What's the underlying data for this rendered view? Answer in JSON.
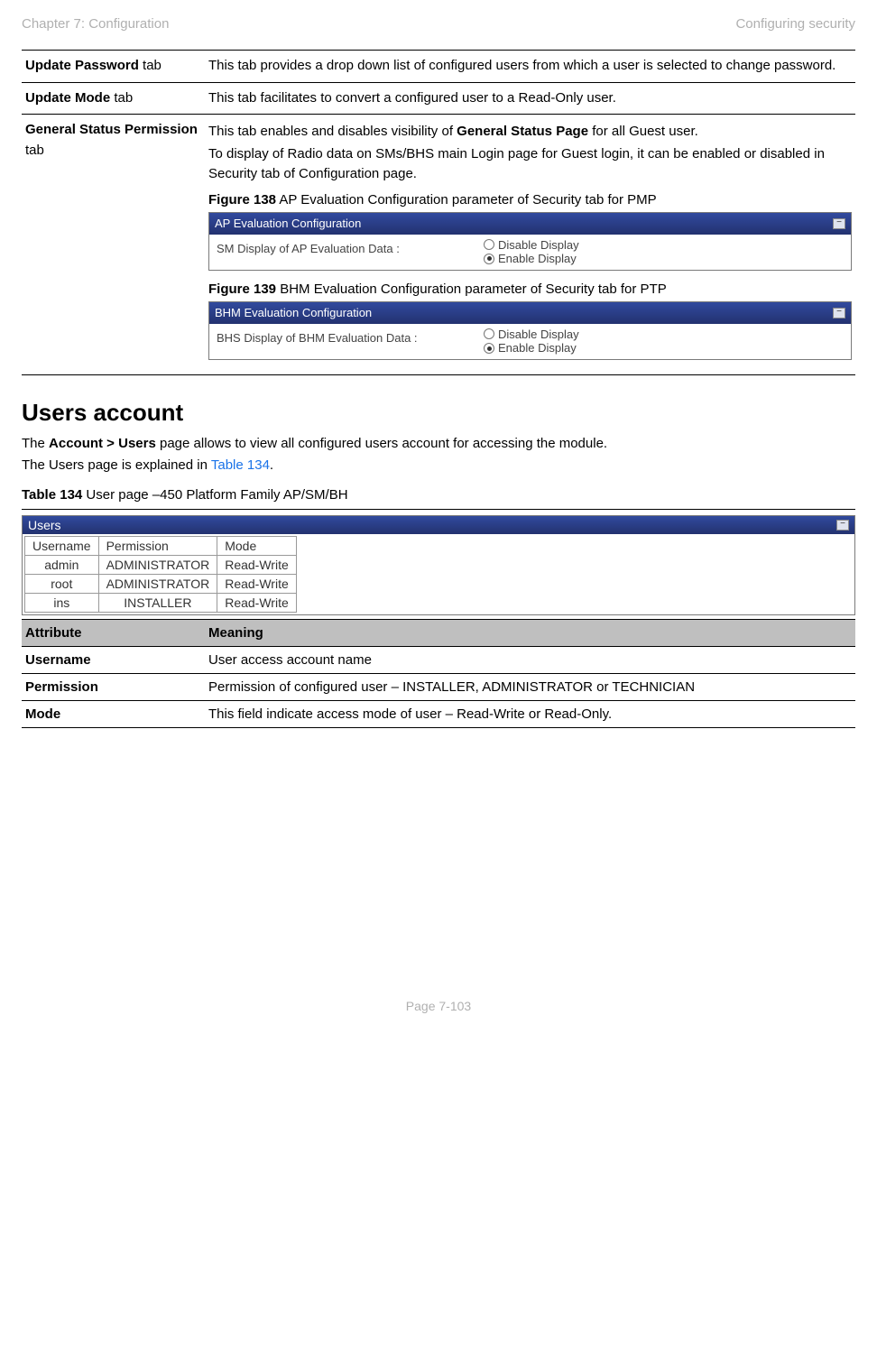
{
  "header": {
    "left": "Chapter 7:  Configuration",
    "right": "Configuring security"
  },
  "tabTable": {
    "rows": [
      {
        "label_bold": "Update Password",
        "label_suffix": " tab",
        "desc": "This tab provides a drop down list of configured users from which a user is selected to change password."
      },
      {
        "label_bold": "Update Mode",
        "label_suffix": " tab",
        "desc": "This tab facilitates to convert a configured user to a Read-Only user."
      },
      {
        "label_bold": "General Status Permission",
        "label_suffix": " tab",
        "desc_pre": "This tab enables and disables visibility of ",
        "desc_bold": "General Status Page",
        "desc_post": " for all Guest user.",
        "desc_para2": "To display of Radio data on SMs/BHS main Login page for Guest login, it can be enabled or disabled in Security tab of Configuration page."
      }
    ],
    "figures": {
      "f138": {
        "caption_bold": "Figure 138",
        "caption_rest": " AP Evaluation Configuration parameter of Security tab for PMP",
        "panel_title": "AP Evaluation Configuration",
        "field_label": "SM Display of AP Evaluation Data :",
        "opt_disable": "Disable Display",
        "opt_enable": "Enable Display"
      },
      "f139": {
        "caption_bold": "Figure 139",
        "caption_rest": " BHM Evaluation Configuration parameter of Security tab for PTP",
        "panel_title": "BHM Evaluation Configuration",
        "field_label": "BHS Display of BHM Evaluation Data :",
        "opt_disable": "Disable Display",
        "opt_enable": "Enable Display"
      }
    }
  },
  "section": {
    "heading": "Users account",
    "p1_pre": "The ",
    "p1_bold": "Account > Users",
    "p1_post": " page allows to view all configured users account for accessing the module.",
    "p2_pre": "The Users page is explained in ",
    "p2_link": "Table 134",
    "p2_post": ".",
    "tbl_caption_bold": "Table 134",
    "tbl_caption_rest": " User page –450 Platform Family AP/SM/BH"
  },
  "usersPanel": {
    "title": "Users",
    "columns": [
      "Username",
      "Permission",
      "Mode"
    ],
    "rows": [
      {
        "u": "admin",
        "p": "ADMINISTRATOR",
        "m": "Read-Write"
      },
      {
        "u": "root",
        "p": "ADMINISTRATOR",
        "m": "Read-Write"
      },
      {
        "u": "ins",
        "p": "INSTALLER",
        "m": "Read-Write"
      }
    ]
  },
  "attrTable": {
    "header": {
      "c1": "Attribute",
      "c2": "Meaning"
    },
    "rows": [
      {
        "c1": "Username",
        "c2": "User access account name"
      },
      {
        "c1": "Permission",
        "c2": "Permission of configured user – INSTALLER, ADMINISTRATOR or TECHNICIAN"
      },
      {
        "c1": "Mode",
        "c2": "This field indicate access mode of user – Read-Write or Read-Only."
      }
    ]
  },
  "footer": "Page 7-103"
}
